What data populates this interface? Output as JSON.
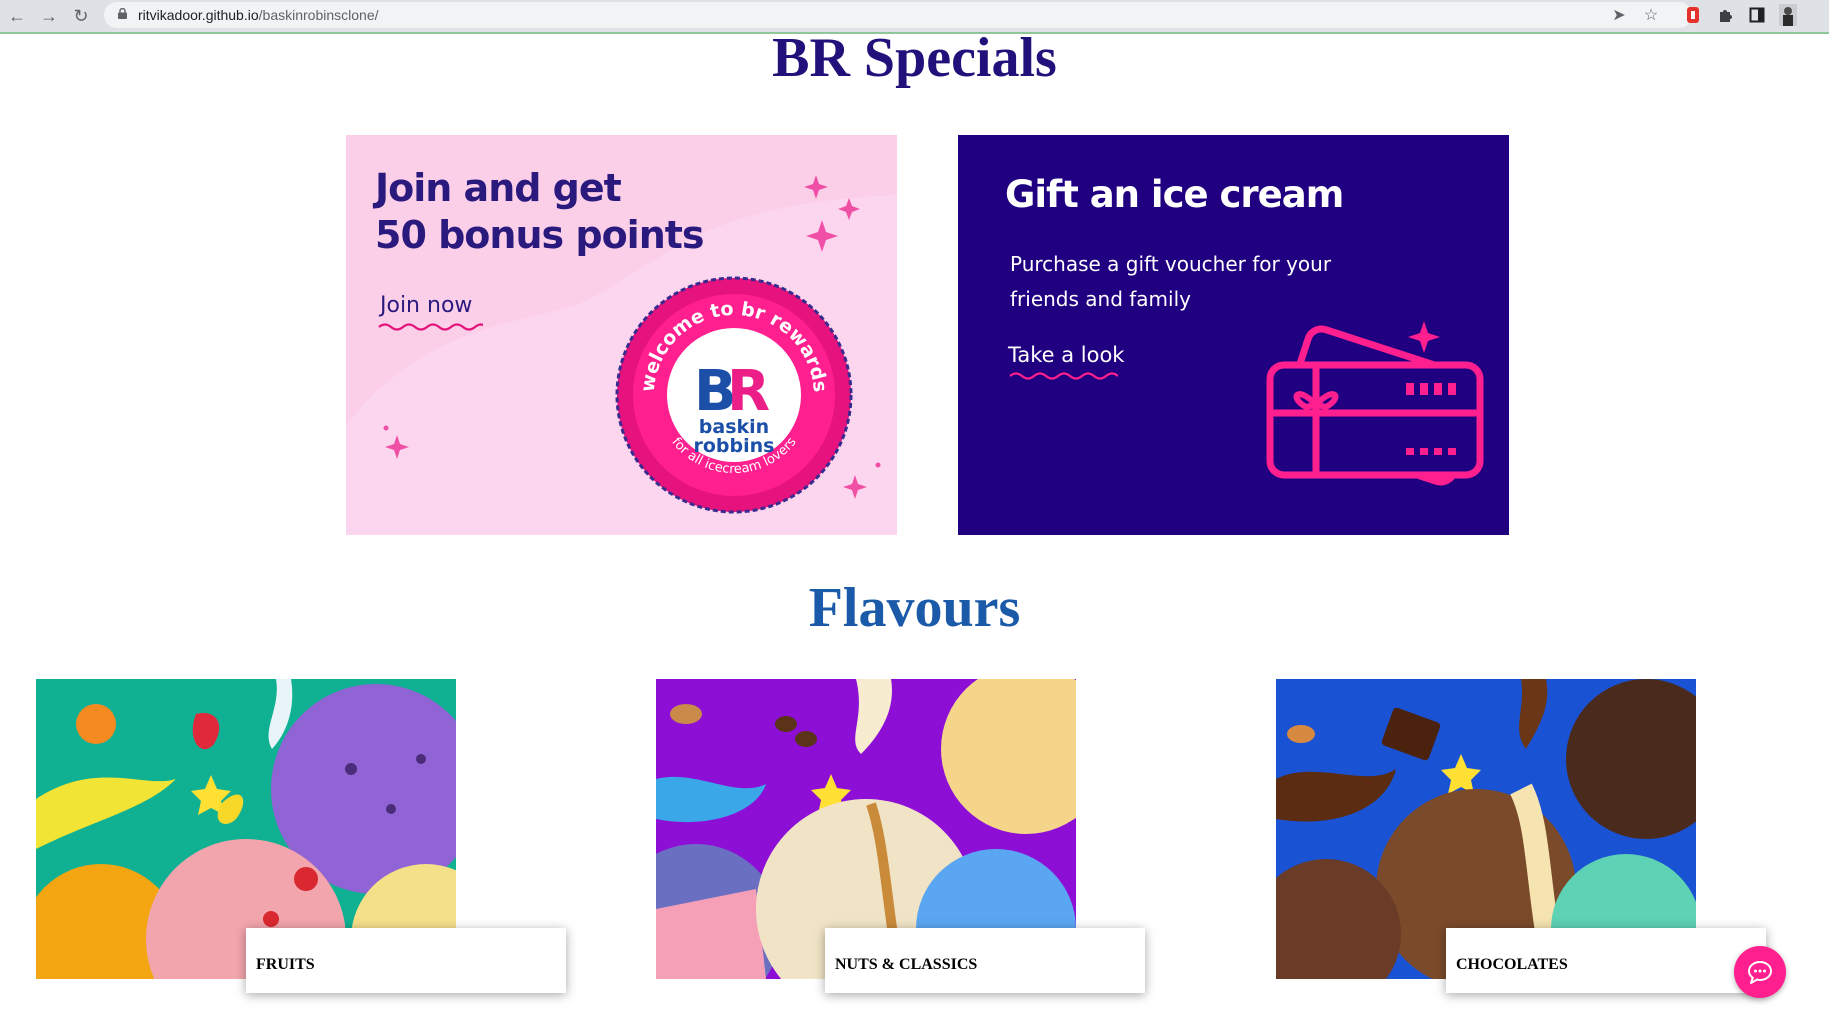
{
  "browser": {
    "url_host": "ritvikadoor.github.io",
    "url_path": "/baskinrobinsclone/"
  },
  "specials": {
    "title": "BR Specials",
    "join_card": {
      "heading_line1": "Join and get",
      "heading_line2": "50 bonus points",
      "link": "Join now",
      "badge_top": "welcome to br rewards",
      "badge_bottom": "for all icecream lovers",
      "logo_line1": "baskin",
      "logo_line2": "robbins"
    },
    "gift_card": {
      "heading": "Gift an ice cream",
      "body": "Purchase a gift voucher for your friends and family",
      "link": "Take a look"
    }
  },
  "flavours": {
    "title": "Flavours",
    "items": [
      {
        "label": "FRUITS"
      },
      {
        "label": "NUTS & CLASSICS"
      },
      {
        "label": "CHOCOLATES"
      }
    ]
  },
  "colors": {
    "specials_title": "#22117a",
    "flavours_title": "#1a5aa8",
    "join_bg": "#fccfe9",
    "gift_bg": "#200080",
    "accent_pink": "#ff1f8e"
  }
}
